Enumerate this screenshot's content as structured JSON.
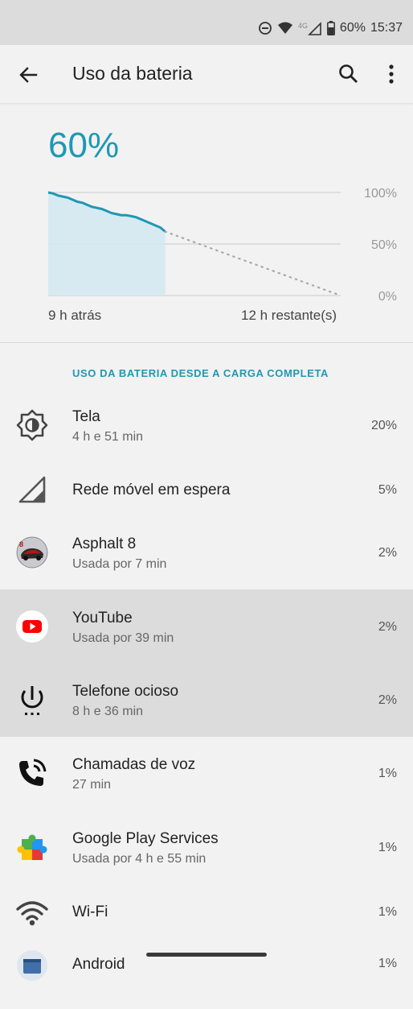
{
  "status_bar": {
    "battery_percent": "60%",
    "time": "15:37",
    "network_type": "4G",
    "icons": [
      "do-not-disturb-icon",
      "wifi-icon",
      "cell-signal-icon",
      "battery-icon"
    ]
  },
  "app_bar": {
    "title": "Uso da bateria",
    "back_icon": "arrow-left-icon",
    "search_icon": "search-icon",
    "more_icon": "more-vert-icon"
  },
  "battery": {
    "level": "60%",
    "graph": {
      "y_tick_labels": [
        "100%",
        "50%",
        "0%"
      ],
      "x_left_label": "9 h atrás",
      "x_right_label": "12 h restante(s)",
      "history_fraction_of_time": 0.4,
      "history_levels_percent": [
        100,
        99,
        97,
        96,
        95,
        93,
        91,
        90,
        88,
        86,
        85,
        84,
        82,
        80,
        79,
        78,
        78,
        77,
        76,
        74,
        72,
        70,
        68,
        66,
        62
      ],
      "projected_end_percent": 0,
      "accent_color": "#1e98b4"
    }
  },
  "section": {
    "header": "USO DA BATERIA DESDE A CARGA COMPLETA"
  },
  "items": [
    {
      "title": "Tela",
      "subtitle": "4 h e 51 min",
      "percent": "20%",
      "icon": "brightness-icon"
    },
    {
      "title": "Rede móvel em espera",
      "subtitle": "",
      "percent": "5%",
      "icon": "cell-signal-icon"
    },
    {
      "title": "Asphalt 8",
      "subtitle": "Usada por 7 min",
      "percent": "2%",
      "icon": "asphalt-8-app-icon"
    },
    {
      "title": "YouTube",
      "subtitle": "Usada por 39 min",
      "percent": "2%",
      "icon": "youtube-app-icon"
    },
    {
      "title": "Telefone ocioso",
      "subtitle": "8 h e 36 min",
      "percent": "2%",
      "icon": "power-icon"
    },
    {
      "title": "Chamadas de voz",
      "subtitle": "27 min",
      "percent": "1%",
      "icon": "phone-call-icon"
    },
    {
      "title": "Google Play Services",
      "subtitle": "Usada por 4 h e 55 min",
      "percent": "1%",
      "icon": "google-play-services-icon"
    },
    {
      "title": "Wi-Fi",
      "subtitle": "",
      "percent": "1%",
      "icon": "wifi-icon"
    },
    {
      "title": "Android",
      "subtitle": "",
      "percent": "1%",
      "icon": "android-app-icon"
    }
  ],
  "colors": {
    "accent": "#1e98b4",
    "highlight_row": "#dcdcdc",
    "background": "#f2f2f2"
  }
}
